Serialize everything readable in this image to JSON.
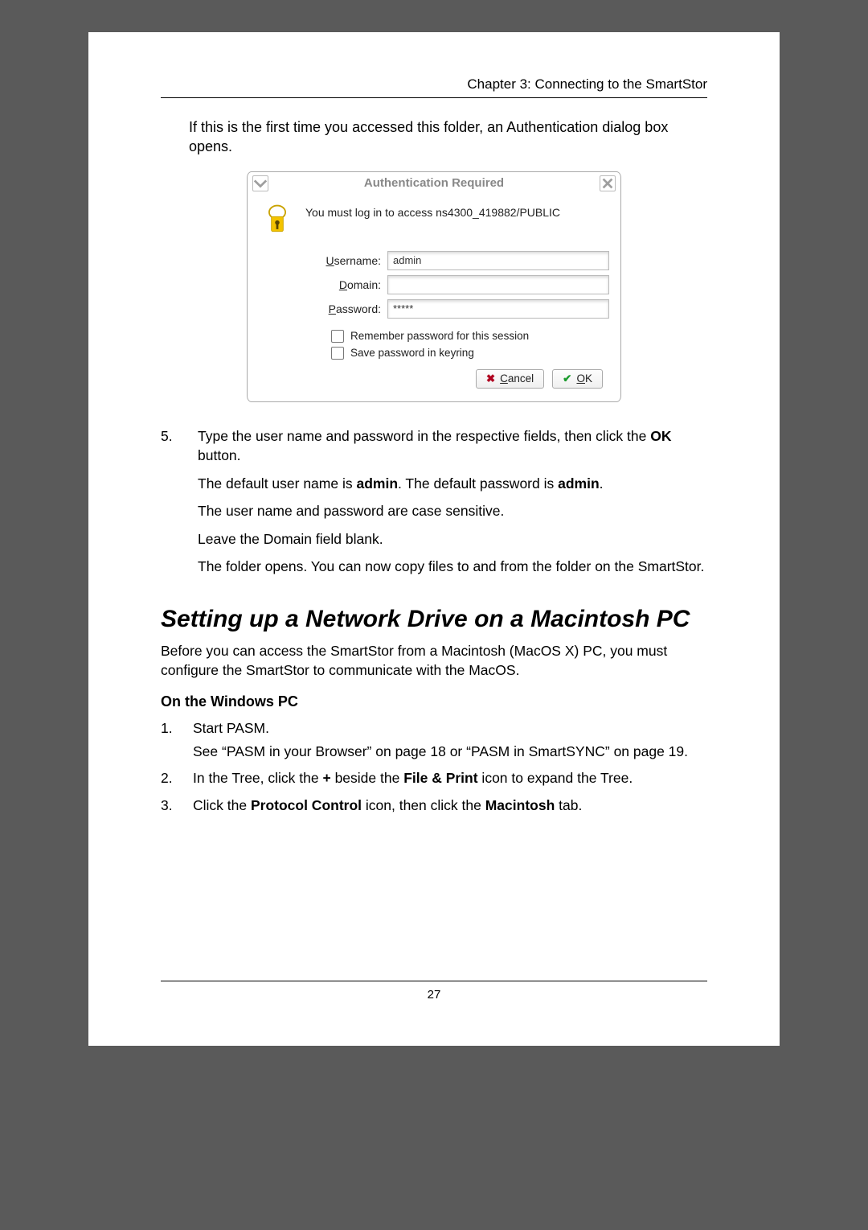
{
  "header": {
    "running": "Chapter 3: Connecting to the SmartStor"
  },
  "intro": "If this is the first time you accessed this folder, an Authentication dialog box opens.",
  "dialog": {
    "title": "Authentication Required",
    "message": "You must log in to access ns4300_419882/PUBLIC",
    "labels": {
      "username": "sername:",
      "u_pre": "U",
      "domain": "omain:",
      "d_pre": "D",
      "password": "assword:",
      "p_pre": "P"
    },
    "values": {
      "username": "admin",
      "domain": "",
      "password": "*****"
    },
    "checks": {
      "remember": "Remember password for this session",
      "keyring": "Save password in keyring"
    },
    "buttons": {
      "cancel_pre": "C",
      "cancel": "ancel",
      "ok_pre": "O",
      "ok": "K"
    }
  },
  "step5": {
    "num": "5.",
    "line1a": "Type the user name and password in the respective fields, then click the ",
    "line1b": "OK",
    "line1c": " button.",
    "line2a": "The default user name is ",
    "line2b": "admin",
    "line2c": ". The default password is ",
    "line2d": "admin",
    "line2e": ".",
    "line3": "The user name and password are case sensitive.",
    "line4": "Leave the Domain field blank.",
    "line5": "The folder opens. You can now copy files to and from the folder on the SmartStor."
  },
  "section": {
    "h1": "Setting up a Network Drive on a Macintosh PC",
    "intro": "Before you can access the SmartStor from a Macintosh (MacOS X) PC, you must configure the SmartStor to communicate with the MacOS.",
    "h3": "On the Windows PC",
    "steps": {
      "s1a": "Start PASM.",
      "s1b": "See “PASM in your Browser” on page 18 or “PASM in SmartSYNC” on page 19.",
      "s2a": "In the Tree, click the ",
      "s2b": "+",
      "s2c": " beside the ",
      "s2d": "File & Print",
      "s2e": " icon to expand the Tree.",
      "s3a": "Click the ",
      "s3b": "Protocol Control",
      "s3c": " icon, then click the ",
      "s3d": "Macintosh",
      "s3e": " tab."
    }
  },
  "footer": {
    "page": "27"
  }
}
